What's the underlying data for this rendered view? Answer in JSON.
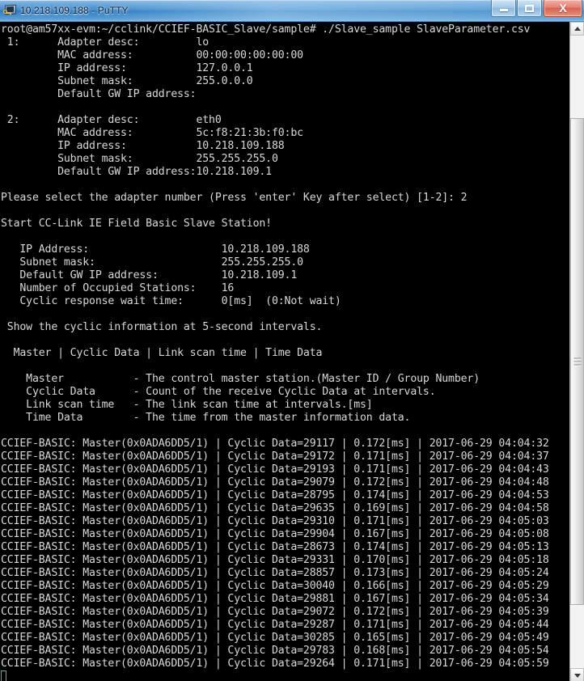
{
  "window": {
    "title": "10.218.109.188 - PuTTY",
    "icon": "putty-icon",
    "minimize_label": "–",
    "maximize_label": "□",
    "close_label": "X"
  },
  "terminal": {
    "prompt_line": "root@am57xx-evm:~/cclink/CCIEF-BASIC_Slave/sample# ./Slave_sample SlaveParameter.csv",
    "adapters": [
      {
        "index": "1:",
        "rows": [
          {
            "label": "Adapter desc:",
            "value": "lo"
          },
          {
            "label": "MAC address:",
            "value": "00:00:00:00:00:00"
          },
          {
            "label": "IP address:",
            "value": "127.0.0.1"
          },
          {
            "label": "Subnet mask:",
            "value": "255.0.0.0"
          },
          {
            "label": "Default GW IP address:",
            "value": ""
          }
        ]
      },
      {
        "index": "2:",
        "rows": [
          {
            "label": "Adapter desc:",
            "value": "eth0"
          },
          {
            "label": "MAC address:",
            "value": "5c:f8:21:3b:f0:bc"
          },
          {
            "label": "IP address:",
            "value": "10.218.109.188"
          },
          {
            "label": "Subnet mask:",
            "value": "255.255.255.0"
          },
          {
            "label": "Default GW IP address:",
            "value": "10.218.109.1"
          }
        ]
      }
    ],
    "select_prompt": "Please select the adapter number (Press 'enter' Key after select) [1-2]: 2",
    "start_banner": "Start CC-Link IE Field Basic Slave Station!",
    "station_info": [
      {
        "label": "IP Address:",
        "value": "10.218.109.188"
      },
      {
        "label": "Subnet mask:",
        "value": "255.255.255.0"
      },
      {
        "label": "Default GW IP address:",
        "value": "10.218.109.1"
      },
      {
        "label": "Number of Occupied Stations:",
        "value": "16"
      },
      {
        "label": "Cyclic response wait time:",
        "value": "0[ms]  (0:Not wait)"
      }
    ],
    "interval_note": "Show the cyclic information at 5-second intervals.",
    "column_header": "Master | Cyclic Data | Link scan time | Time Data",
    "legend": [
      {
        "term": "Master",
        "desc": "- The control master station.(Master ID / Group Number)"
      },
      {
        "term": "Cyclic Data",
        "desc": "- Count of the receive Cyclic Data at intervals."
      },
      {
        "term": "Link scan time",
        "desc": "- The link scan time at intervals.[ms]"
      },
      {
        "term": "Time Data",
        "desc": "- The time from the master information data."
      }
    ],
    "log_prefix": "CCIEF-BASIC: Master(0x0ADA6DD5/1)",
    "log_entries": [
      {
        "master": "Master(0x0ADA6DD5/1)",
        "cyclic_data": "29117",
        "scan_time": "0.172[ms]",
        "timestamp": "2017-06-29 04:04:32"
      },
      {
        "master": "Master(0x0ADA6DD5/1)",
        "cyclic_data": "29172",
        "scan_time": "0.171[ms]",
        "timestamp": "2017-06-29 04:04:37"
      },
      {
        "master": "Master(0x0ADA6DD5/1)",
        "cyclic_data": "29193",
        "scan_time": "0.171[ms]",
        "timestamp": "2017-06-29 04:04:43"
      },
      {
        "master": "Master(0x0ADA6DD5/1)",
        "cyclic_data": "29079",
        "scan_time": "0.172[ms]",
        "timestamp": "2017-06-29 04:04:48"
      },
      {
        "master": "Master(0x0ADA6DD5/1)",
        "cyclic_data": "28795",
        "scan_time": "0.174[ms]",
        "timestamp": "2017-06-29 04:04:53"
      },
      {
        "master": "Master(0x0ADA6DD5/1)",
        "cyclic_data": "29635",
        "scan_time": "0.169[ms]",
        "timestamp": "2017-06-29 04:04:58"
      },
      {
        "master": "Master(0x0ADA6DD5/1)",
        "cyclic_data": "29310",
        "scan_time": "0.171[ms]",
        "timestamp": "2017-06-29 04:05:03"
      },
      {
        "master": "Master(0x0ADA6DD5/1)",
        "cyclic_data": "29904",
        "scan_time": "0.167[ms]",
        "timestamp": "2017-06-29 04:05:08"
      },
      {
        "master": "Master(0x0ADA6DD5/1)",
        "cyclic_data": "28673",
        "scan_time": "0.174[ms]",
        "timestamp": "2017-06-29 04:05:13"
      },
      {
        "master": "Master(0x0ADA6DD5/1)",
        "cyclic_data": "29331",
        "scan_time": "0.170[ms]",
        "timestamp": "2017-06-29 04:05:18"
      },
      {
        "master": "Master(0x0ADA6DD5/1)",
        "cyclic_data": "28857",
        "scan_time": "0.173[ms]",
        "timestamp": "2017-06-29 04:05:24"
      },
      {
        "master": "Master(0x0ADA6DD5/1)",
        "cyclic_data": "30040",
        "scan_time": "0.166[ms]",
        "timestamp": "2017-06-29 04:05:29"
      },
      {
        "master": "Master(0x0ADA6DD5/1)",
        "cyclic_data": "29881",
        "scan_time": "0.167[ms]",
        "timestamp": "2017-06-29 04:05:34"
      },
      {
        "master": "Master(0x0ADA6DD5/1)",
        "cyclic_data": "29072",
        "scan_time": "0.172[ms]",
        "timestamp": "2017-06-29 04:05:39"
      },
      {
        "master": "Master(0x0ADA6DD5/1)",
        "cyclic_data": "29287",
        "scan_time": "0.171[ms]",
        "timestamp": "2017-06-29 04:05:44"
      },
      {
        "master": "Master(0x0ADA6DD5/1)",
        "cyclic_data": "30285",
        "scan_time": "0.165[ms]",
        "timestamp": "2017-06-29 04:05:49"
      },
      {
        "master": "Master(0x0ADA6DD5/1)",
        "cyclic_data": "29783",
        "scan_time": "0.168[ms]",
        "timestamp": "2017-06-29 04:05:54"
      },
      {
        "master": "Master(0x0ADA6DD5/1)",
        "cyclic_data": "29264",
        "scan_time": "0.171[ms]",
        "timestamp": "2017-06-29 04:05:59"
      }
    ],
    "colors": {
      "background": "#000000",
      "foreground": "#d8d8d8",
      "cursor": "#1ae61a"
    }
  },
  "scrollbar": {
    "up_arrow": "scroll-up-arrow",
    "down_arrow": "scroll-down-arrow",
    "thumb_top_pct": 13,
    "thumb_height_pct": 77
  }
}
